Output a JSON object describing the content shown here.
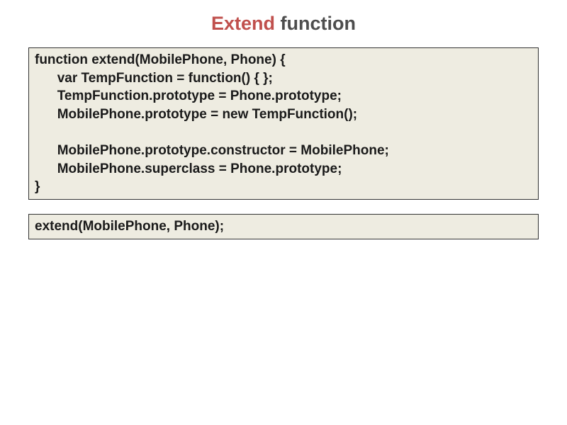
{
  "title": {
    "accent": "Extend",
    "rest": " function"
  },
  "codeBlock1": "function extend(MobilePhone, Phone) {\n      var TempFunction = function() { };\n      TempFunction.prototype = Phone.prototype;\n      MobilePhone.prototype = new TempFunction();\n\n      MobilePhone.prototype.constructor = MobilePhone;\n      MobilePhone.superclass = Phone.prototype;\n}",
  "codeBlock2": "extend(MobilePhone, Phone);"
}
